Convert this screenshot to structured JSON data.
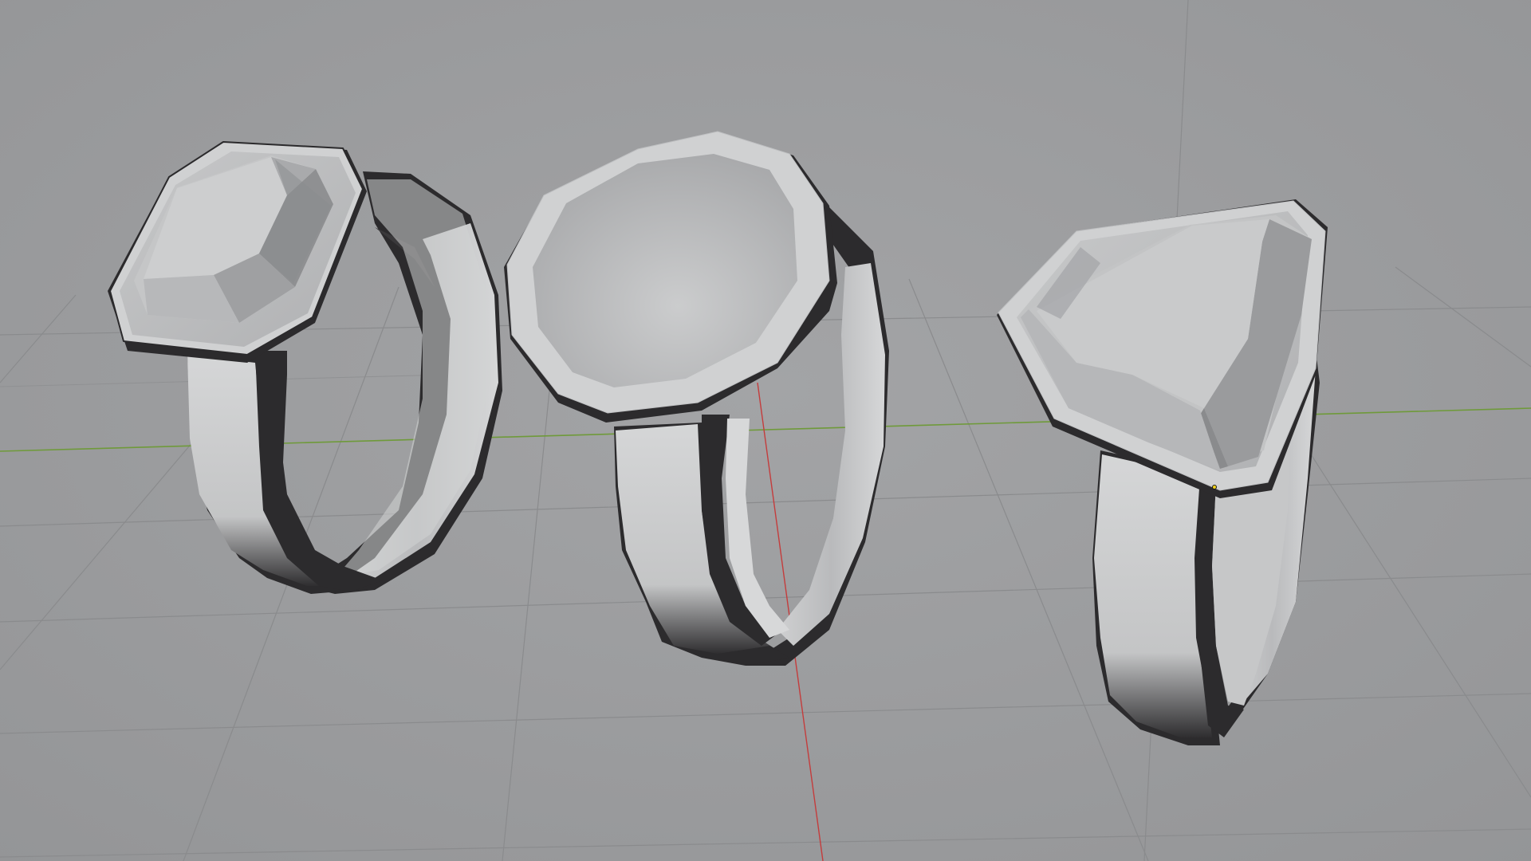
{
  "viewport": {
    "kind": "3d-viewport",
    "background_color": "#9b9c9e",
    "grid_color": "#8a8b8d",
    "x_axis_color": "#c43c3c",
    "y_axis_color": "#6f9a3a"
  },
  "objects": [
    {
      "name": "octagon-ring",
      "shape": "octagonal faceted top"
    },
    {
      "name": "round-signet-ring",
      "shape": "decagonal flat top"
    },
    {
      "name": "shield-signet-ring",
      "shape": "triangular faceted top"
    }
  ],
  "material": {
    "surface_light": "#d3d4d5",
    "surface_mid": "#b3b4b6",
    "surface_dark": "#2c2b2d"
  }
}
